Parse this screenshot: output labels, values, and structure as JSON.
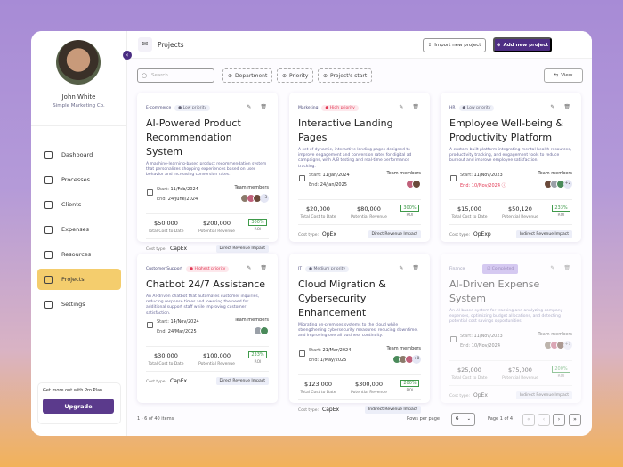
{
  "user": {
    "name": "John White",
    "company": "Simple Marketing Co."
  },
  "nav": [
    {
      "label": "Dashboard",
      "icon": "dashboard-icon"
    },
    {
      "label": "Processes",
      "icon": "processes-icon"
    },
    {
      "label": "Clients",
      "icon": "clients-icon"
    },
    {
      "label": "Expenses",
      "icon": "expenses-icon"
    },
    {
      "label": "Resources",
      "icon": "resources-icon"
    },
    {
      "label": "Projects",
      "icon": "projects-icon",
      "active": true
    },
    {
      "label": "Settings",
      "icon": "settings-icon"
    }
  ],
  "promo": {
    "text": "Get more out with Pro Plan",
    "button": "Upgrade"
  },
  "header": {
    "title": "Projects",
    "import": "Import new project",
    "add": "Add new project"
  },
  "filters": {
    "search_placeholder": "Search",
    "department": "Department",
    "priority": "Priority",
    "start": "Project's start",
    "view": "View"
  },
  "labels": {
    "team": "Team members",
    "cost": "Total Cost to Date",
    "revenue": "Potential Revenue",
    "roi": "ROI",
    "cost_type": "Cost type:",
    "start": "Start:",
    "end": "End:"
  },
  "projects": [
    {
      "dept": "E-commerce",
      "priority": "Low priority",
      "ptype": "low",
      "title": "AI-Powered Product Recommendation System",
      "desc": "A machine-learning-based product recommendation system that personalizes shopping experiences based on user behavior and increasing conversion rates.",
      "start": "11/Feb/2024",
      "end": "24/June/2024",
      "members": 3,
      "extra": "+3",
      "cost": "$50,000",
      "revenue": "$200,000",
      "roi": "300%",
      "cost_type": "CapEx",
      "impact": "Direct Revenue Impact"
    },
    {
      "dept": "Marketing",
      "priority": "High priority",
      "ptype": "high",
      "title": "Interactive Landing Pages",
      "desc": "A set of dynamic, interactive landing pages designed to improve engagement and conversion rates for digital ad campaigns, with A/B testing and real-time performance tracking.",
      "start": "11/Jan/2024",
      "end": "24/Jan/2025",
      "members": 2,
      "extra": "",
      "cost": "$20,000",
      "revenue": "$80,000",
      "roi": "300%",
      "cost_type": "OpEx",
      "impact": "Direct Revenue Impact"
    },
    {
      "dept": "HR",
      "priority": "Low priority",
      "ptype": "low",
      "title": "Employee Well-being & Productivity Platform",
      "desc": "A custom-built platform integrating mental health resources, productivity tracking, and engagement tools to reduce burnout and improve employee satisfaction.",
      "start": "11/Nov/2023",
      "end": "10/Nov/2024",
      "late": true,
      "members": 3,
      "extra": "+2",
      "cost": "$15,000",
      "revenue": "$50,120",
      "roi": "233%",
      "cost_type": "OpExp",
      "impact": "Indirect Revenue Impact"
    },
    {
      "dept": "Customer Support",
      "priority": "Highest priority",
      "ptype": "high",
      "title": "Chatbot 24/7 Assistance",
      "desc": "An AI-driven chatbot that automates customer inquiries, reducing response times and lowering the need for additional support staff while improving customer satisfaction.",
      "start": "14/Nov/2024",
      "end": "24/Mar/2025",
      "members": 2,
      "extra": "",
      "cost": "$30,000",
      "revenue": "$100,000",
      "roi": "233%",
      "cost_type": "CapEx",
      "impact": "Direct Revenue Impact"
    },
    {
      "dept": "IT",
      "priority": "Medium priority",
      "ptype": "low",
      "title": "Cloud Migration & Cybersecurity Enhancement",
      "desc": "Migrating on-premises systems to the cloud while strengthening cybersecurity measures, reducing downtime, and improving overall business continuity.",
      "start": "21/Mar/2024",
      "end": "1/May/2025",
      "members": 3,
      "extra": "+8",
      "cost": "$123,000",
      "revenue": "$300,000",
      "roi": "200%",
      "cost_type": "CapEx",
      "impact": "Indirect Revenue Impact"
    },
    {
      "dept": "Finance",
      "priority": "Completed",
      "ptype": "done",
      "title": "AI-Driven Expense System",
      "desc": "An AI-based system for tracking and analyzing company expenses, optimizing budget allocations, and detecting potential cost savings opportunities.",
      "start": "11/Nov/2023",
      "end": "10/Nov/2024",
      "members": 3,
      "extra": "+1",
      "cost": "$25,000",
      "revenue": "$75,000",
      "roi": "200%",
      "cost_type": "OpEx",
      "impact": "Indirect Revenue Impact"
    }
  ],
  "footer": {
    "items": "1 - 6 of 40 items",
    "rows_label": "Rows per page",
    "rows_value": "6",
    "page": "Page 1 of 4"
  },
  "colors": {
    "accent": "#4e2e84",
    "active_nav": "#f4cd6d",
    "high": "#e23a55",
    "roi": "#3f9a4a"
  }
}
